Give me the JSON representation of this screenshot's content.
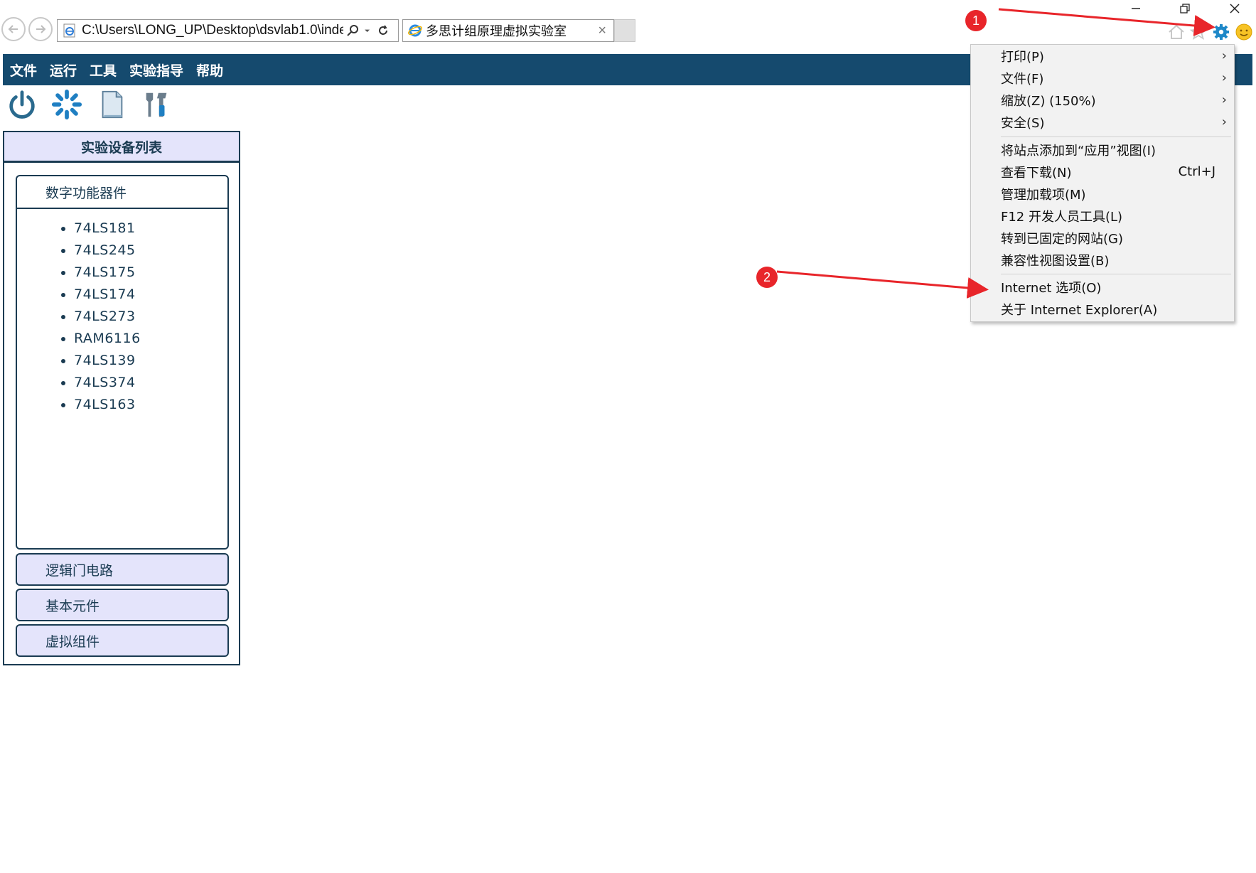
{
  "browser": {
    "address_url": "C:\\Users\\LONG_UP\\Desktop\\dsvlab1.0\\inde",
    "tab_title": "多思计组原理虚拟实验室",
    "tab_close": "×"
  },
  "app": {
    "menu": [
      "文件",
      "运行",
      "工具",
      "实验指导",
      "帮助"
    ],
    "toolbar_icons": [
      "power-icon",
      "loading-icon",
      "document-icon",
      "tools-icon"
    ]
  },
  "panel": {
    "title": "实验设备列表",
    "open_group": {
      "label": "数字功能器件",
      "items": [
        "74LS181",
        "74LS245",
        "74LS175",
        "74LS174",
        "74LS273",
        "RAM6116",
        "74LS139",
        "74LS374",
        "74LS163"
      ]
    },
    "groups": [
      "逻辑门电路",
      "基本元件",
      "虚拟组件"
    ]
  },
  "context_menu": {
    "items": [
      {
        "label": "打印(P)",
        "submenu": true
      },
      {
        "label": "文件(F)",
        "submenu": true
      },
      {
        "label": "缩放(Z) (150%)",
        "submenu": true
      },
      {
        "label": "安全(S)",
        "submenu": true
      },
      {
        "label": "将站点添加到“应用”视图(I)"
      },
      {
        "label": "查看下载(N)",
        "shortcut": "Ctrl+J"
      },
      {
        "label": "管理加载项(M)"
      },
      {
        "label": "F12 开发人员工具(L)"
      },
      {
        "label": "转到已固定的网站(G)"
      },
      {
        "label": "兼容性视图设置(B)"
      },
      {
        "label": "Internet 选项(O)"
      },
      {
        "label": "关于 Internet Explorer(A)"
      }
    ],
    "arrow": "›"
  },
  "annotations": {
    "badge1": "1",
    "badge2": "2",
    "color": "#e8252a"
  },
  "colors": {
    "menubar_bg": "#154a6e",
    "panel_header_bg": "#e4e4fb",
    "panel_border": "#1a3b52",
    "gear_icon": "#1e88c8"
  }
}
